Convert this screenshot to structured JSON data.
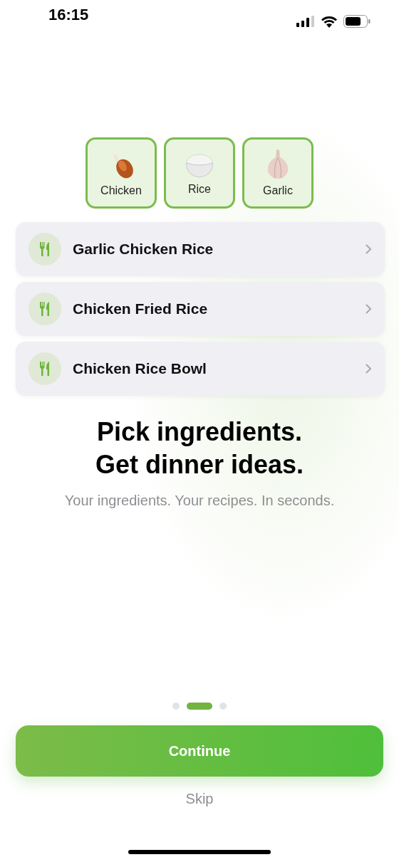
{
  "status_bar": {
    "time": "16:15"
  },
  "ingredients": [
    {
      "label": "Chicken",
      "kind": "drumstick",
      "selected": true
    },
    {
      "label": "Rice",
      "kind": "rice",
      "selected": true
    },
    {
      "label": "Garlic",
      "kind": "garlic",
      "selected": true
    }
  ],
  "recipes": [
    {
      "title": "Garlic Chicken Rice"
    },
    {
      "title": "Chicken Fried Rice"
    },
    {
      "title": "Chicken Rice Bowl"
    }
  ],
  "headline": [
    "Pick ingredients.",
    "Get dinner ideas."
  ],
  "subtitle": "Your ingredients. Your recipes. In seconds.",
  "pages": [
    {
      "selected": false
    },
    {
      "selected": true
    },
    {
      "selected": false
    }
  ],
  "primary_button": "Continue",
  "secondary_button": "Skip"
}
